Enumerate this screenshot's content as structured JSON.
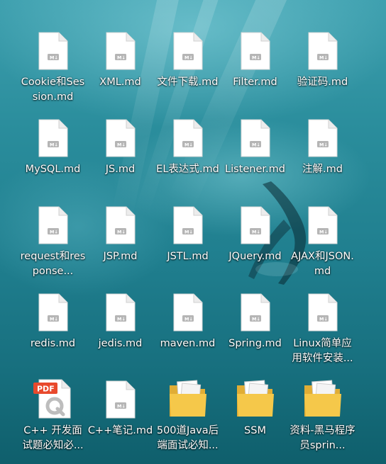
{
  "desktop": {
    "icons": [
      {
        "label": "Cookie和Session.md",
        "type": "md"
      },
      {
        "label": "XML.md",
        "type": "md"
      },
      {
        "label": "文件下载.md",
        "type": "md"
      },
      {
        "label": "Filter.md",
        "type": "md"
      },
      {
        "label": "验证码.md",
        "type": "md"
      },
      {
        "label": "MySQL.md",
        "type": "md"
      },
      {
        "label": "JS.md",
        "type": "md"
      },
      {
        "label": "EL表达式.md",
        "type": "md"
      },
      {
        "label": "Listener.md",
        "type": "md"
      },
      {
        "label": "注解.md",
        "type": "md"
      },
      {
        "label": "request和response...",
        "type": "md"
      },
      {
        "label": "JSP.md",
        "type": "md"
      },
      {
        "label": "JSTL.md",
        "type": "md"
      },
      {
        "label": "JQuery.md",
        "type": "md"
      },
      {
        "label": "AJAX和JSON.md",
        "type": "md"
      },
      {
        "label": "redis.md",
        "type": "md"
      },
      {
        "label": "jedis.md",
        "type": "md"
      },
      {
        "label": "maven.md",
        "type": "md"
      },
      {
        "label": "Spring.md",
        "type": "md"
      },
      {
        "label": "Linux简单应用软件安装...",
        "type": "md"
      },
      {
        "label": "C++ 开发面试题必知必...",
        "type": "pdf",
        "badge": "PDF"
      },
      {
        "label": "C++笔记.md",
        "type": "md"
      },
      {
        "label": "500道Java后端面试必知...",
        "type": "folder"
      },
      {
        "label": "SSM",
        "type": "folder"
      },
      {
        "label": "资料-黑马程序员sprin...",
        "type": "folder"
      }
    ]
  },
  "colors": {
    "water_top": "#3d9fae",
    "water_bottom": "#0f5f6c",
    "pdf_badge": "#e8492c",
    "folder": "#f5c84a"
  }
}
